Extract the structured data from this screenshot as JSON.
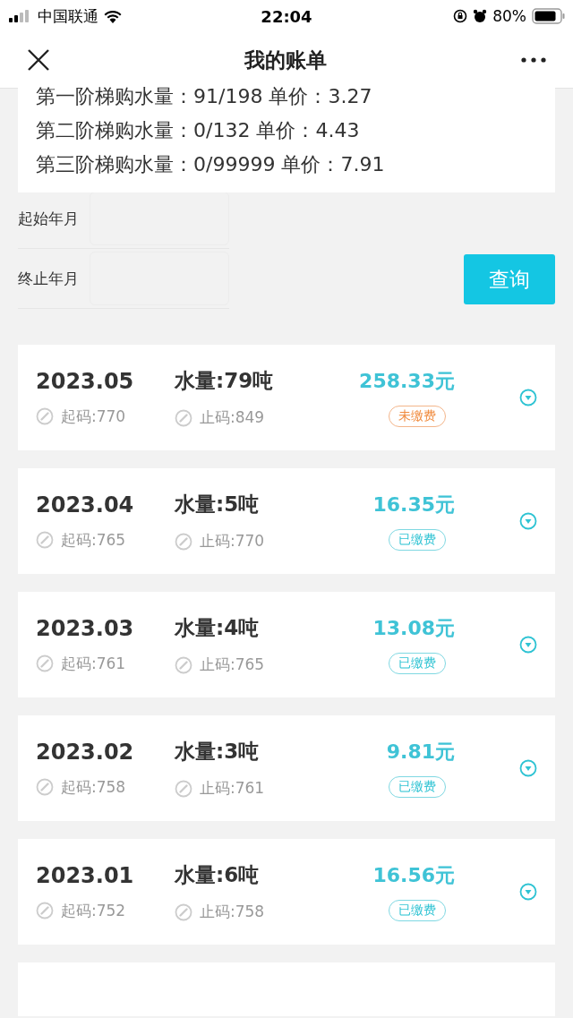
{
  "status_bar": {
    "carrier": "中国联通",
    "time": "22:04",
    "battery": "80%"
  },
  "nav": {
    "title": "我的账单"
  },
  "tiers": [
    "第一阶梯购水量：91/198 单价：3.27",
    "第二阶梯购水量：0/132 单价：4.43",
    "第三阶梯购水量：0/99999 单价：7.91"
  ],
  "filters": [
    {
      "label": "起始年月"
    },
    {
      "label": "终止年月"
    }
  ],
  "query_button": "查询",
  "bills": [
    {
      "month": "2023.05",
      "water": "水量:79吨",
      "amount": "258.33元",
      "start": "起码:770",
      "end": "止码:849",
      "status": "未缴费",
      "paid": false
    },
    {
      "month": "2023.04",
      "water": "水量:5吨",
      "amount": "16.35元",
      "start": "起码:765",
      "end": "止码:770",
      "status": "已缴费",
      "paid": true
    },
    {
      "month": "2023.03",
      "water": "水量:4吨",
      "amount": "13.08元",
      "start": "起码:761",
      "end": "止码:765",
      "status": "已缴费",
      "paid": true
    },
    {
      "month": "2023.02",
      "water": "水量:3吨",
      "amount": "9.81元",
      "start": "起码:758",
      "end": "止码:761",
      "status": "已缴费",
      "paid": true
    },
    {
      "month": "2023.01",
      "water": "水量:6吨",
      "amount": "16.56元",
      "start": "起码:752",
      "end": "止码:758",
      "status": "已缴费",
      "paid": true
    }
  ]
}
